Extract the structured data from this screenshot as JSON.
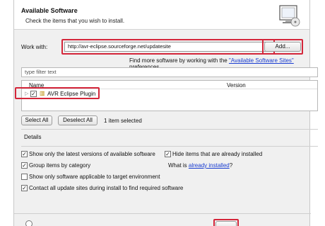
{
  "header": {
    "title": "Available Software",
    "subtitle": "Check the items that you wish to install."
  },
  "site": {
    "work_with_label": "Work with:",
    "url": "http://avr-eclipse.sourceforge.net/updatesite",
    "add_button": "Add...",
    "find_more_prefix": "Find more software by working with the",
    "find_more_link": "\"Available Software Sites\"",
    "find_more_suffix": "preferences."
  },
  "filter": {
    "placeholder": "type filter text"
  },
  "table": {
    "columns": [
      "Name",
      "Version"
    ],
    "rows": [
      {
        "name": "AVR Eclipse Plugin",
        "checked": true
      }
    ]
  },
  "selection": {
    "select_all": "Select All",
    "deselect_all": "Deselect All",
    "status": "1 item selected"
  },
  "details": {
    "label": "Details"
  },
  "options": {
    "latest_versions": {
      "label": "Show only the latest versions of available software",
      "checked": true
    },
    "group_by_category": {
      "label": "Group items by category",
      "checked": true
    },
    "target_env": {
      "label": "Show only software applicable to target environment",
      "checked": false
    },
    "contact_sites": {
      "label": "Contact all update sites during install to find required software",
      "checked": true
    },
    "hide_installed": {
      "label": "Hide items that are already installed",
      "checked": true
    },
    "what_is_prefix": "What is",
    "what_is_link": "already installed",
    "what_is_suffix": "?"
  },
  "colors": {
    "highlight": "#d4263a",
    "link": "#1a3dd1"
  }
}
